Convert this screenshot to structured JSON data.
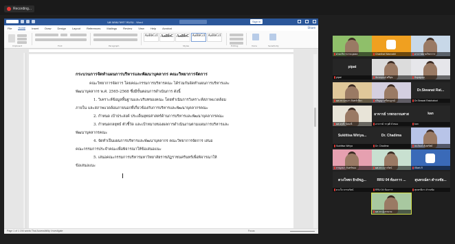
{
  "meeting": {
    "recording_label": "Recording..."
  },
  "word": {
    "autosave_label": "AutoSave",
    "doc_title": "นพ.จดหมายข่าวชมรม - Word",
    "signin_label": "Sign in",
    "share_label": "Share",
    "menu": [
      "File",
      "Home",
      "Insert",
      "Draw",
      "Design",
      "Layout",
      "References",
      "Mailings",
      "Review",
      "View",
      "Help",
      "Acrobat"
    ],
    "styles": [
      "AaBbCcI",
      "AaBbC",
      "AaBbC",
      "AaBbCcI",
      "AaBbCcI"
    ],
    "style_names": [
      "Emphasis",
      "Heading 1",
      "Heading 2",
      "Normal",
      "Strong",
      "Subtitle"
    ],
    "ribbon_groups": [
      "Clipboard",
      "Font",
      "Paragraph",
      "Styles",
      "Editing",
      "Voice",
      "Sensitivity"
    ],
    "heading": "กระบวนการจัดทำแผนการบริหารและพัฒนาบุคลากร คณะวิทยาการจัดการ",
    "paragraphs": [
      "คณะวิทยาการจัดการ โดยคณะกรรมการบริหารคณะ ได้ร่วมกันจัดทำแผนการบริหารและ",
      "พัฒนาบุคลากร พ.ศ. 2565-2568 ซึ่งมีขั้นตอนการดำเนินการ ดังนี้",
      "1.  วิเคราะห์ข้อมูลพื้นฐานและบริบทของคณะ โดยทำเนินการวิเคราะห์สภาพแวดล้อม",
      "ภายใน และสภาพแวดล้อมภายนอกที่เกี่ยวข้องกับการบริหารและพัฒนาบุคลากรคณะ",
      "2.  กำหนด เป้าประสงค์ ประเด็นยุทธศาสตร์ด้านการบริหารและพัฒนาบุคลากรคณะ",
      "3.  กำหนดกลยุทธ์  ตัวชี้วัด และเป้าหมายของผลการดำเนินงานตามแผนการบริหารและ",
      "พัฒนาบุคลากรคณะ",
      "4.  จัดทำเป็นแผนการบริหารและพัฒนาบุคลากร คณะวิทยาการจัดการ  เสนอ",
      "คณะกรรมการประจำคณะเพื่อพิจารณาให้ข้อเสนอแนะ",
      "5.  เสนอคณะกรรมการบริหารมหาวิทยาลัยราชภัฏราชนครินทร์เพื่อพิจารณาให้",
      "ข้อเสนอแนะ"
    ],
    "status_left": "Page 1 of 1   194 words   Thai   Accessibility: Investigate",
    "status_right": "Focus"
  },
  "participants": [
    {
      "caption": "ฝ่ายบริหารงานบุคคล",
      "kind": "video",
      "color": "#8fbf6a"
    },
    {
      "caption": "Chanthat Wannakit",
      "kind": "logo",
      "color": "#f0a020"
    },
    {
      "caption": "อาจารย์ฝ่ายวิชาการ",
      "kind": "video",
      "color": "#c8d8e8"
    },
    {
      "caption": "pipat",
      "kind": "name",
      "label": "pipat"
    },
    {
      "caption": "จักรกฤษณ์ ศรีสุข",
      "kind": "video",
      "color": "#dcdcdc"
    },
    {
      "caption": "Supaporn",
      "kind": "video",
      "color": "#e6e6ea"
    },
    {
      "caption": "ผศ.ดร.รุ่งนภา จันทร์เขียว",
      "kind": "video",
      "color": "#e0c89a"
    },
    {
      "caption": "ปริญญา ศรีสมบูรณ์",
      "kind": "video",
      "color": "#d4cfe0"
    },
    {
      "caption": "Dr.Sirawat Ratchaburi",
      "kind": "name",
      "label": "Dr.Siwanat Rat..."
    },
    {
      "caption": "ผศ.อรุณี นิลมณี",
      "kind": "video",
      "color": "#e8e4d8"
    },
    {
      "caption": "อาจารย์ วรวุฒิ บัวทอง",
      "kind": "name",
      "label": "อาจารย์ วรพรธรรมศาส"
    },
    {
      "caption": "kan",
      "kind": "name",
      "label": "kan"
    },
    {
      "caption": "Sukittisa Wiriya",
      "kind": "name",
      "label": "Sukittisa  Wiriya..."
    },
    {
      "caption": "Dr. Chadima",
      "kind": "name",
      "label": "Dr. Chadima"
    },
    {
      "caption": "ธนวัฒน์ คุ้มทรัพย์",
      "kind": "video",
      "color": "#b8c4e8"
    },
    {
      "caption": "กาญจนา จันทร์ทอง",
      "kind": "video",
      "color": "#e6a0b0"
    },
    {
      "caption": "ผศ.ดร.เนาวรัตน์",
      "kind": "video",
      "color": "#c8e0d0"
    },
    {
      "caption": "IStart-R",
      "kind": "logo",
      "color": "#3a6ab8"
    },
    {
      "caption": "ดวงใจ ธรรมรัตน์",
      "kind": "name",
      "label": "ดวงใจพร ธิรอัชฎ..."
    },
    {
      "caption": "RRU 04 ห้องการ",
      "kind": "name",
      "label": "RRU 04 ห้องการ ..."
    },
    {
      "caption": "สุนทรนิภา ดำรงชัย",
      "kind": "name",
      "label": "สุนทรณ์ดา ดำรงชัย..."
    },
    {
      "caption": "ผศ.ดร.ผู้บรรยาย",
      "kind": "video",
      "color": "#a8c8a0"
    }
  ]
}
